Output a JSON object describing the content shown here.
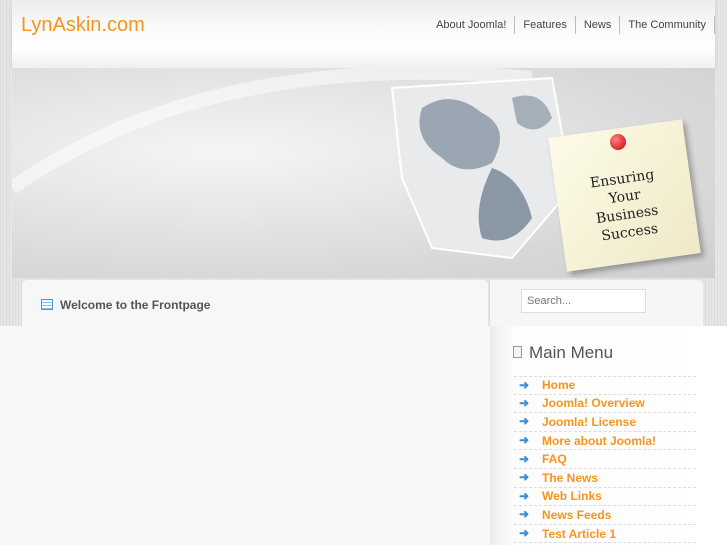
{
  "header": {
    "logo": "LynAskin.com",
    "nav": [
      "About Joomla!",
      "Features",
      "News",
      "The Community"
    ]
  },
  "banner": {
    "note_lines": [
      "Ensuring Your",
      "Business",
      "Success"
    ]
  },
  "content": {
    "title": "Welcome to the Frontpage"
  },
  "sidebar": {
    "search_placeholder": "Search...",
    "menu_title": "Main Menu",
    "menu": [
      "Home",
      "Joomla! Overview",
      "Joomla! License",
      "More about Joomla!",
      "FAQ",
      "The News",
      "Web Links",
      "News Feeds",
      "Test Article 1"
    ]
  },
  "colors": {
    "accent": "#f7941d",
    "arrow": "#3a8fd8"
  }
}
